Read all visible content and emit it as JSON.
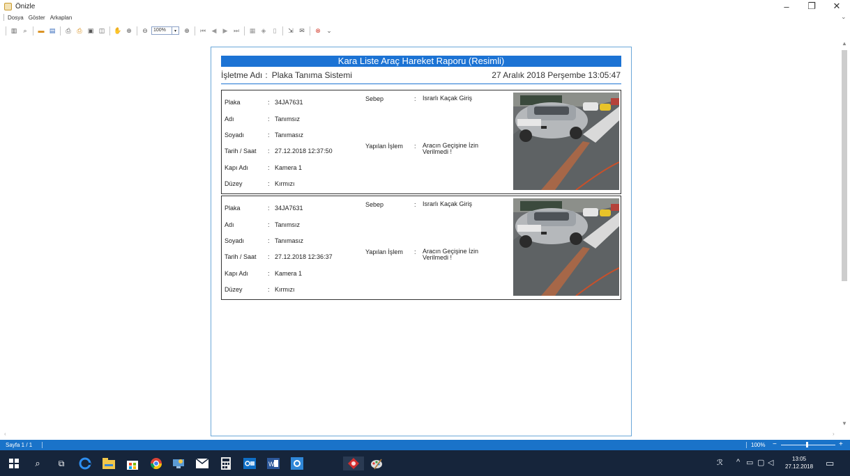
{
  "window": {
    "title": "Önizle",
    "min_glyph": "–",
    "max_glyph": "❐",
    "close_glyph": "✕"
  },
  "menu": {
    "items": [
      {
        "label": "Dosya"
      },
      {
        "label": "Göster"
      },
      {
        "label": "Arkaplan"
      }
    ]
  },
  "toolbar": {
    "zoom_value": "100%"
  },
  "report": {
    "title": "Kara Liste Araç Hareket Raporu (Resimli)",
    "company_label": "İşletme Adı",
    "company_sep": ":",
    "company_name": "Plaka Tanıma Sistemi",
    "date": "27 Aralık 2018 Perşembe 13:05:47",
    "field_labels": {
      "plaka": "Plaka",
      "adi": "Adı",
      "soyadi": "Soyadı",
      "tarih": "Tarih / Saat",
      "kapi": "Kapı Adı",
      "duzey": "Düzey",
      "sebep": "Sebep",
      "islem": "Yapılan İşlem"
    },
    "colon": ":",
    "records": [
      {
        "plaka": "34JA7631",
        "adi": "Tanımsız",
        "soyadi": "Tanımasız",
        "tarih": "27.12.2018 12:37:50",
        "kapi": "Kamera 1",
        "duzey": "Kırmızı",
        "sebep": "Israrlı Kaçak Giriş",
        "islem": "Aracın Geçişine İzin Verilmedi !"
      },
      {
        "plaka": "34JA7631",
        "adi": "Tanımsız",
        "soyadi": "Tanımasız",
        "tarih": "27.12.2018 12:36:37",
        "kapi": "Kamera 1",
        "duzey": "Kırmızı",
        "sebep": "Israrlı Kaçak Giriş",
        "islem": "Aracın Geçişine İzin Verilmedi !"
      }
    ]
  },
  "statusbar": {
    "page_indicator": "Sayfa 1 / 1",
    "zoom_percent": "100%",
    "zoom_minus": "−",
    "zoom_plus": "+"
  },
  "taskbar": {
    "clock_time": "13:05",
    "clock_date": "27.12.2018"
  },
  "colors": {
    "accent": "#1c73d4",
    "statusbar": "#1a73c9",
    "taskbar": "#16253b"
  }
}
